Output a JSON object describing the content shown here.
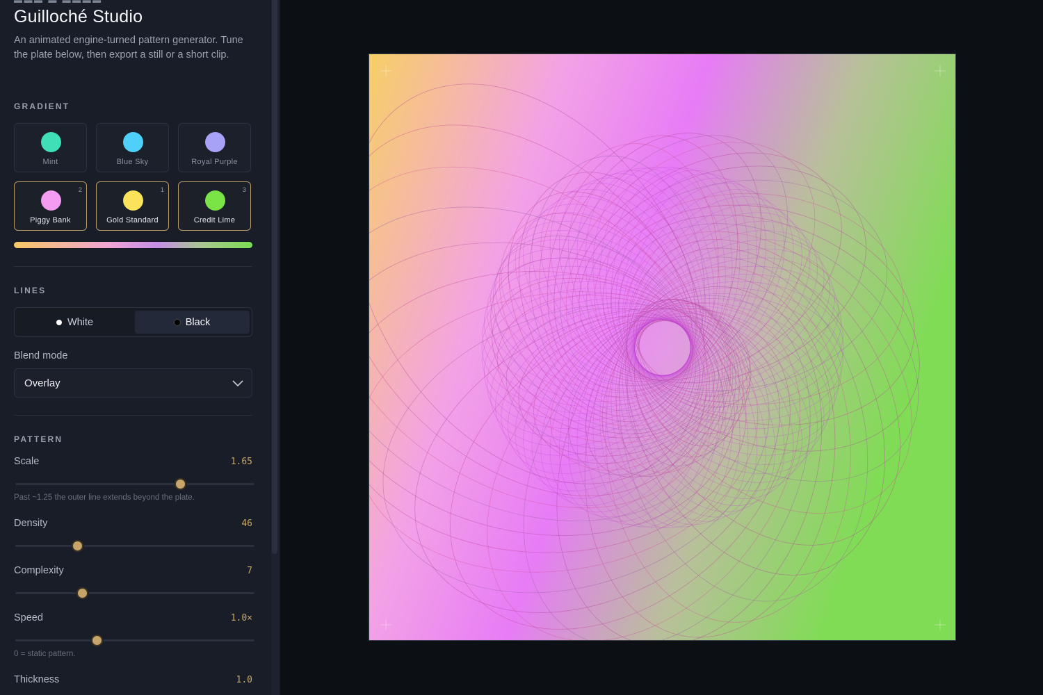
{
  "app": {
    "title": "Guilloché Studio",
    "description": "An animated engine-turned pattern generator. Tune the plate below, then export a still or a short clip."
  },
  "gradient": {
    "section_label": "GRADIENT",
    "swatches": [
      {
        "name": "Mint",
        "color": "#3fe0b7",
        "selected": false,
        "order": ""
      },
      {
        "name": "Blue Sky",
        "color": "#4fd0f9",
        "selected": false,
        "order": ""
      },
      {
        "name": "Royal Purple",
        "color": "#a8a2f7",
        "selected": false,
        "order": ""
      },
      {
        "name": "Piggy Bank",
        "color": "#f39cf2",
        "selected": true,
        "order": "2"
      },
      {
        "name": "Gold Standard",
        "color": "#fbe25b",
        "selected": true,
        "order": "1"
      },
      {
        "name": "Credit Lime",
        "color": "#7ae447",
        "selected": true,
        "order": "3"
      }
    ]
  },
  "lines": {
    "section_label": "LINES",
    "options": [
      {
        "label": "White",
        "color": "#ffffff",
        "selected": false
      },
      {
        "label": "Black",
        "color": "#000000",
        "selected": true
      }
    ],
    "blend_mode_label": "Blend mode",
    "blend_mode_value": "Overlay"
  },
  "pattern": {
    "section_label": "PATTERN",
    "scale": {
      "label": "Scale",
      "display": "1.65",
      "level": 0.69,
      "hint": "Past ~1.25 the outer line extends beyond the plate."
    },
    "density": {
      "label": "Density",
      "display": "46",
      "level": 0.26
    },
    "complexity": {
      "label": "Complexity",
      "display": "7",
      "level": 0.28
    },
    "speed": {
      "label": "Speed",
      "display": "1.0×",
      "level": 0.34,
      "hint": "0 = static pattern."
    },
    "thickness": {
      "label": "Thickness",
      "display": "1.0"
    }
  },
  "colors": {
    "accent": "#c7a56a",
    "plate_gradient": [
      "#f7cf66",
      "#f3a2e6",
      "#e77cf6",
      "#b8c09a",
      "#80dc55"
    ]
  }
}
